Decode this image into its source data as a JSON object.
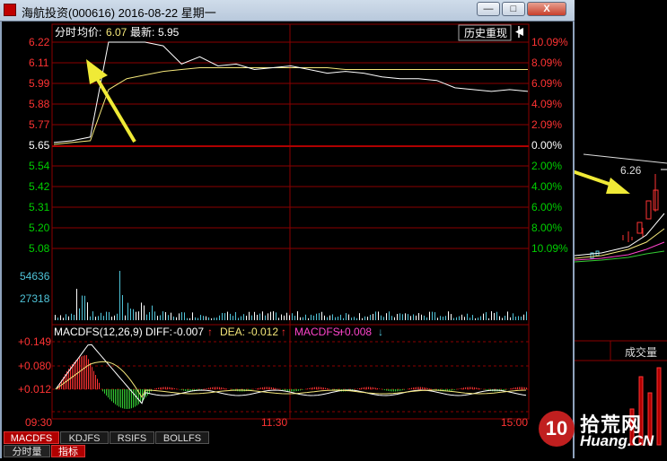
{
  "window": {
    "title": "海航投资(000616) 2016-08-22 星期一",
    "btn_min": "—",
    "btn_max": "□",
    "btn_close": "X"
  },
  "info_bar": {
    "label_fenshi": "分时",
    "label_avg": "均价:",
    "avg_value": "6.07",
    "label_latest": "最新:",
    "latest_value": "5.95",
    "history_button": "历史重现",
    "pin_icon": "pin-icon"
  },
  "price_axis": {
    "left_labels": [
      "6.22",
      "6.11",
      "5.99",
      "5.88",
      "5.77",
      "5.65",
      "5.54",
      "5.42",
      "5.31",
      "5.20",
      "5.08"
    ],
    "right_labels": [
      "10.09%",
      "8.09%",
      "6.09%",
      "4.09%",
      "2.09%",
      "0.00%",
      "2.00%",
      "4.00%",
      "6.00%",
      "8.00%",
      "10.09%"
    ]
  },
  "volume_axis": {
    "labels": [
      "54636",
      "27318"
    ]
  },
  "macd_bar": {
    "name": "MACDFS(12,26,9)",
    "diff_label": "DIFF:",
    "diff_value": "-0.007",
    "dea_label": "DEA:",
    "dea_value": "-0.012",
    "macd_label": "MACDFS:",
    "macd_value": "+0.008"
  },
  "macd_axis": {
    "labels": [
      "+0.149",
      "+0.080",
      "+0.012"
    ]
  },
  "time_axis": {
    "labels": [
      "09:30",
      "11:30",
      "15:00"
    ]
  },
  "indicator_tabs": [
    "MACDFS",
    "KDJFS",
    "RSIFS",
    "BOLLFS"
  ],
  "bottom_tabs": [
    "分时量",
    "指标"
  ],
  "right_panel": {
    "price_label": "6.26",
    "volume_label": "成交量"
  },
  "watermark": {
    "logo_number": "10",
    "site_cn": "拾荒网",
    "site_url": "Huang.CN"
  },
  "colors": {
    "grid_red": "#8b0000",
    "axis_red": "#ff3333",
    "axis_green": "#00d000",
    "axis_cyan": "#4fc3d8",
    "price_line": "#ffffff",
    "avg_line": "#f5e77a",
    "annotation_arrow": "#f0ea36"
  },
  "chart_data": {
    "type": "line",
    "series": [
      {
        "name": "最新",
        "values": [
          5.67,
          5.68,
          5.7,
          6.22,
          6.22,
          6.22,
          6.2,
          6.1,
          6.14,
          6.09,
          6.1,
          6.07,
          6.08,
          6.09,
          6.07,
          6.05,
          6.06,
          6.05,
          6.03,
          6.02,
          6.02,
          6.01,
          5.97,
          5.96,
          5.95,
          5.96,
          5.95
        ]
      },
      {
        "name": "均价",
        "values": [
          5.66,
          5.67,
          5.68,
          5.96,
          6.02,
          6.04,
          6.06,
          6.07,
          6.08,
          6.08,
          6.08,
          6.08,
          6.08,
          6.08,
          6.08,
          6.08,
          6.07,
          6.07,
          6.07,
          6.07,
          6.07,
          6.07,
          6.07,
          6.07,
          6.07,
          6.07,
          6.07
        ]
      }
    ],
    "ylim": [
      5.08,
      6.22
    ]
  }
}
